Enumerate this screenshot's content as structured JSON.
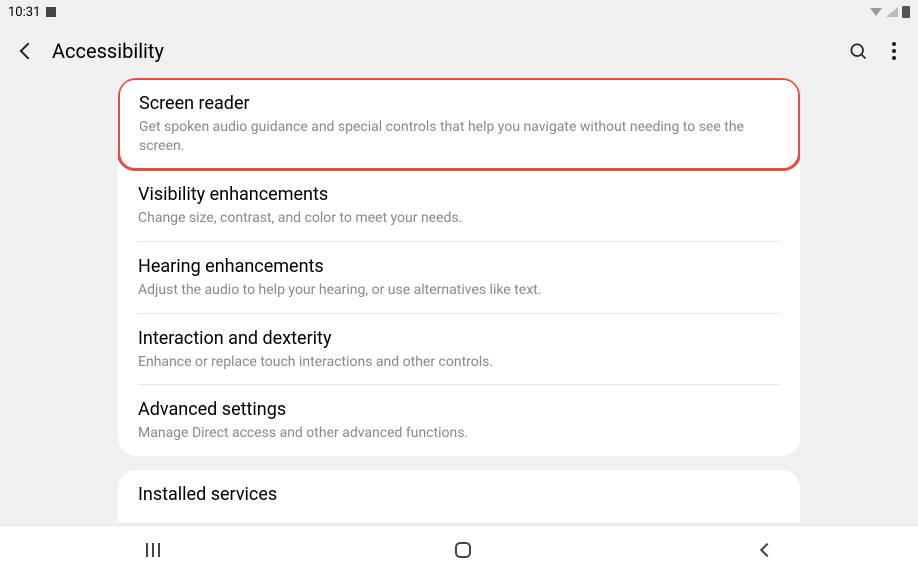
{
  "statusBar": {
    "time": "10:31"
  },
  "header": {
    "title": "Accessibility"
  },
  "settings": [
    {
      "title": "Screen reader",
      "subtitle": "Get spoken audio guidance and special controls that help you navigate without needing to see the screen.",
      "highlighted": true
    },
    {
      "title": "Visibility enhancements",
      "subtitle": "Change size, contrast, and color to meet your needs."
    },
    {
      "title": "Hearing enhancements",
      "subtitle": "Adjust the audio to help your hearing, or use alternatives like text."
    },
    {
      "title": "Interaction and dexterity",
      "subtitle": "Enhance or replace touch interactions and other controls."
    },
    {
      "title": "Advanced settings",
      "subtitle": "Manage Direct access and other advanced functions."
    }
  ],
  "secondCard": {
    "title": "Installed services"
  }
}
